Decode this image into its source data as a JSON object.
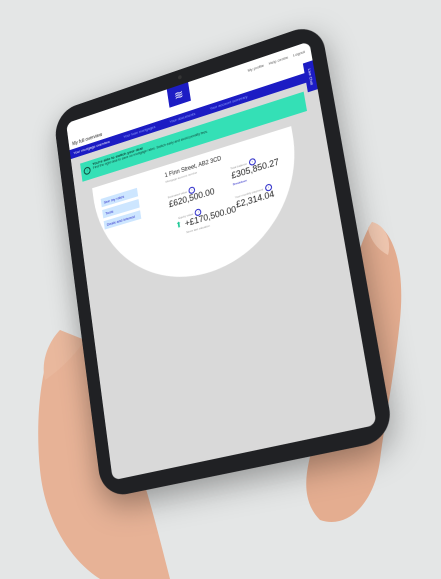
{
  "header": {
    "top_links": [
      "My profile",
      "Help centre",
      "Logout"
    ]
  },
  "title_bar": {
    "label": "My full overview"
  },
  "tabs": [
    {
      "label": "Your mortgage overview",
      "active": true
    },
    {
      "label": "Your loan mortgages",
      "active": false
    },
    {
      "label": "Your documents",
      "active": false
    },
    {
      "label": "Your account summary",
      "active": false
    }
  ],
  "live_chat": {
    "label": "Live Chat"
  },
  "banner": {
    "title": "You're able to switch your deal",
    "body": "Find the right deal to save on mortgage rates. Switch early and avoid penalty fees."
  },
  "card": {
    "side_buttons": [
      "See my rates",
      "Tools",
      "Deals and interest"
    ],
    "address": "1 Finn Street, AB2 3CD",
    "address_sub": "Mortgage account number",
    "estimated_value_label": "Estimated value",
    "estimated_value": "£620,500.00",
    "balance_label": "Total balance",
    "balance": "£305,850.27",
    "balance_link": "Breakdown",
    "equity_label": "Equity value",
    "equity_value": "+£170,500.00",
    "equity_sub": "Since last valuation",
    "monthly_label": "Your monthly payment",
    "monthly_value": "£2,314.04"
  },
  "colors": {
    "brand": "#1c1cc4",
    "banner": "#34e0b6",
    "background": "#e4e6e6",
    "skin": "#e8b39a"
  }
}
